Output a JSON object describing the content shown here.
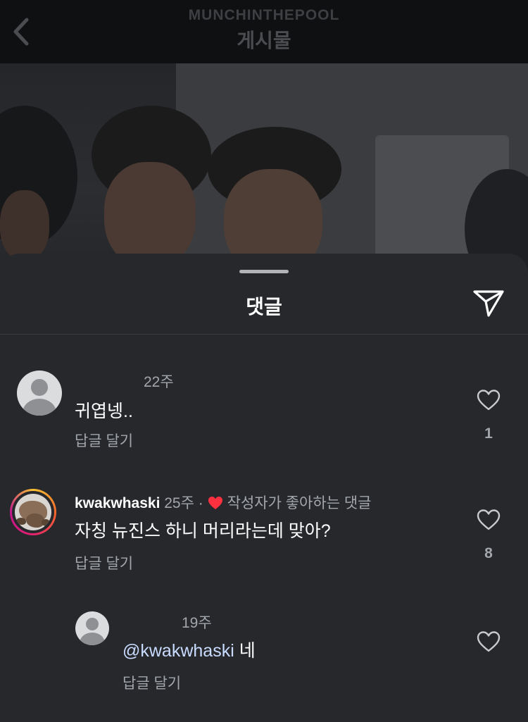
{
  "header": {
    "account": "MUNCHINTHEPOOL",
    "title": "게시물",
    "back_icon": "chevron-left-icon"
  },
  "sheet": {
    "title": "댓글",
    "share_icon": "paper-plane-icon"
  },
  "comments": [
    {
      "username": "",
      "time": "22주",
      "text": "귀엽넹..",
      "reply_label": "답글 달기",
      "likes": "1"
    },
    {
      "username": "kwakwhaski",
      "time": "25주",
      "separator": "·",
      "author_liked_label": "작성자가 좋아하는 댓글",
      "text": "자칭 뉴진스 하니 머리라는데 맞아?",
      "reply_label": "답글 달기",
      "likes": "8"
    }
  ],
  "reply": {
    "username": "",
    "time": "19주",
    "mention": "@kwakwhaski",
    "text": "네",
    "reply_label": "답글 달기"
  },
  "colors": {
    "sheet_bg": "#26282c",
    "liked_heart": "#ff3040",
    "mention": "#c9dcff",
    "secondary_text": "#a3a6ab"
  }
}
